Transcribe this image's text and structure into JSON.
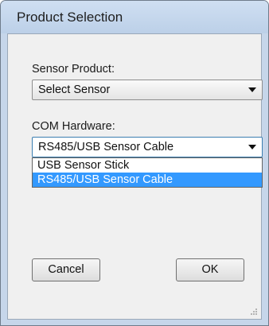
{
  "window": {
    "title": "Product Selection"
  },
  "sensor_product": {
    "label": "Sensor Product:",
    "selected_value": "Select Sensor"
  },
  "com_hardware": {
    "label": "COM Hardware:",
    "selected_value": "RS485/USB Sensor Cable",
    "options": [
      {
        "label": "USB Sensor Stick",
        "selected": false
      },
      {
        "label": "RS485/USB Sensor Cable",
        "selected": true
      }
    ]
  },
  "buttons": {
    "cancel_label": "Cancel",
    "ok_label": "OK"
  },
  "colors": {
    "highlight": "#3399ff",
    "frame": "#c6d6ea",
    "client": "#f0f0f0"
  }
}
